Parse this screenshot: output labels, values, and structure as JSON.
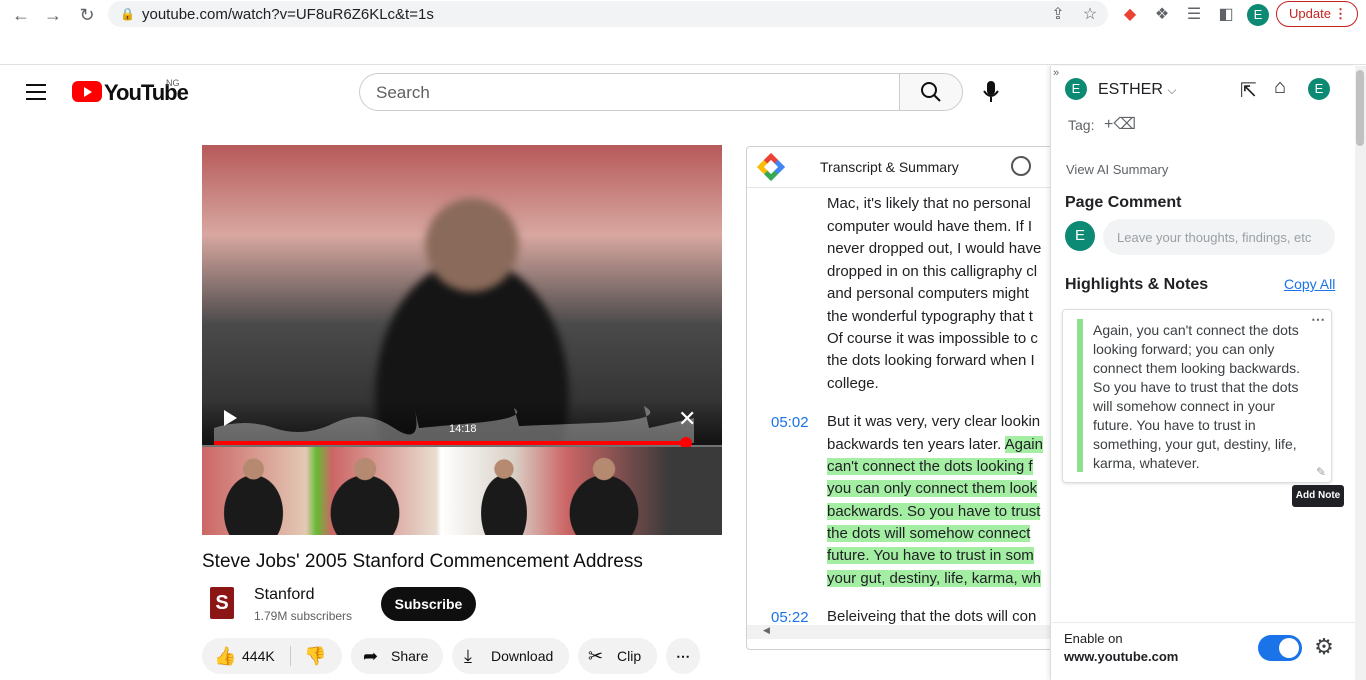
{
  "browser": {
    "url": "youtube.com/watch?v=UF8uR6Z6KLc&t=1s",
    "update_label": "Update",
    "profile_initial": "E"
  },
  "youtube": {
    "wordmark": "YouTube",
    "country": "NG",
    "search_placeholder": "Search",
    "video": {
      "time_label": "14:18",
      "title": "Steve Jobs' 2005 Stanford Commencement Address",
      "progress_fraction": 0.97
    },
    "channel": {
      "logo_letter": "S",
      "name": "Stanford",
      "subscribers": "1.79M subscribers",
      "subscribe_label": "Subscribe"
    },
    "actions": {
      "likes": "444K",
      "share": "Share",
      "download": "Download",
      "clip": "Clip"
    }
  },
  "transcript_panel": {
    "title": "Transcript & Summary",
    "segment1_lines": [
      "Mac, it's likely that no personal",
      "computer would have them. If I",
      "never dropped out, I would have",
      "dropped in on this calligraphy cl",
      "and personal computers might",
      "the wonderful typography that t",
      "Of course it was impossible to c",
      "the dots looking forward when I",
      "college."
    ],
    "segment2": {
      "time": "05:02",
      "line1": "But it was very, very clear lookin",
      "line2_plain": "backwards ten years later. ",
      "line2_hl": "Again",
      "hl_lines": [
        "can't connect the dots looking f",
        "you can only connect them look",
        "backwards. So you have to trust",
        "the dots will somehow connect",
        "future. You have to trust in som",
        "your gut, destiny, life, karma, wh"
      ]
    },
    "segment3": {
      "time": "05:22",
      "line1": "Beleiveing that the dots will con"
    }
  },
  "extension": {
    "user_initial": "E",
    "user_name": "ESTHER",
    "tag_label": "Tag:",
    "view_ai_summary": "View AI Summary",
    "page_comment_title": "Page Comment",
    "comment_placeholder": "Leave your thoughts, findings, etc",
    "highlights_title": "Highlights & Notes",
    "copy_all": "Copy All",
    "note_lines": [
      "Again, you can't connect the dots",
      "looking forward; you can only",
      "connect them looking backwards.",
      "So you have to trust that the dots",
      "will somehow connect in your",
      "future. You have to trust in",
      "something, your gut, destiny, life,",
      "karma, whatever."
    ],
    "add_note_tooltip": "Add Note",
    "enable_on": "Enable on",
    "enable_site": "www.youtube.com",
    "enabled": true
  }
}
